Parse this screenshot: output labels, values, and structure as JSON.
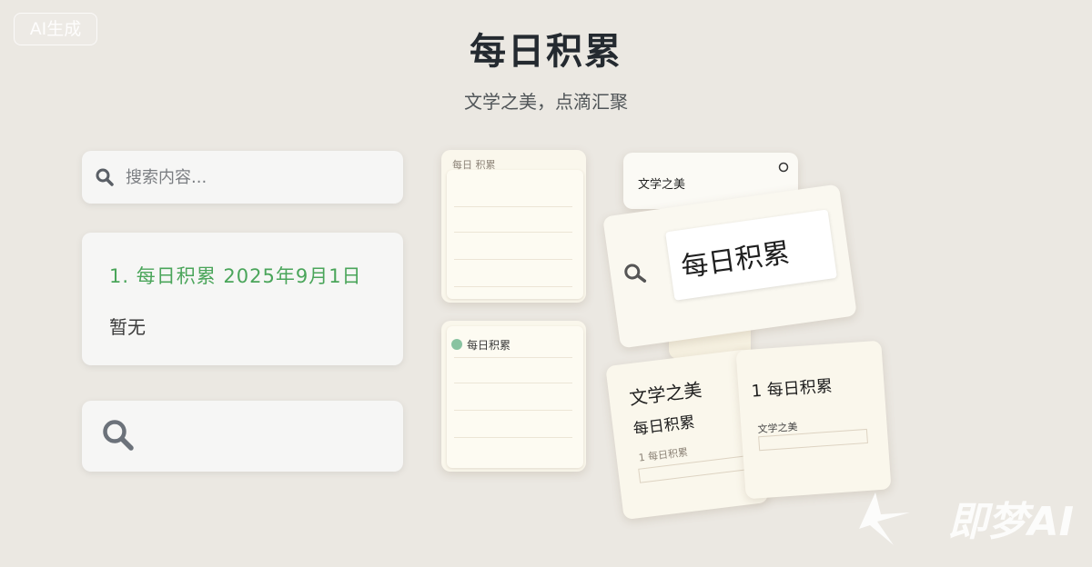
{
  "badge": "AI生成",
  "header": {
    "title": "每日积累",
    "subtitle": "文学之美，点滴汇聚"
  },
  "search": {
    "placeholder": "搜索内容..."
  },
  "entry": {
    "title": "1. 每日积累 2025年9月1日",
    "body": "暂无"
  },
  "mockups": {
    "card1_header": "每日 积累",
    "card2_header": "每日积累",
    "card3_top": "文学之美",
    "card3_big": "每日积累",
    "card4_title": "文学之美",
    "card4_sub": "每日积累",
    "card4_line": "1 每日积累",
    "card5_title": "1 每日积累",
    "card5_sub": "文学之美"
  },
  "watermark": "即梦AI",
  "colors": {
    "accent_green": "#4aa55a",
    "background": "#ebe8e2",
    "card": "#f6f6f5",
    "paper": "#faf7ec"
  },
  "icons": {
    "search": "search-icon",
    "search_large": "search-icon-large"
  }
}
